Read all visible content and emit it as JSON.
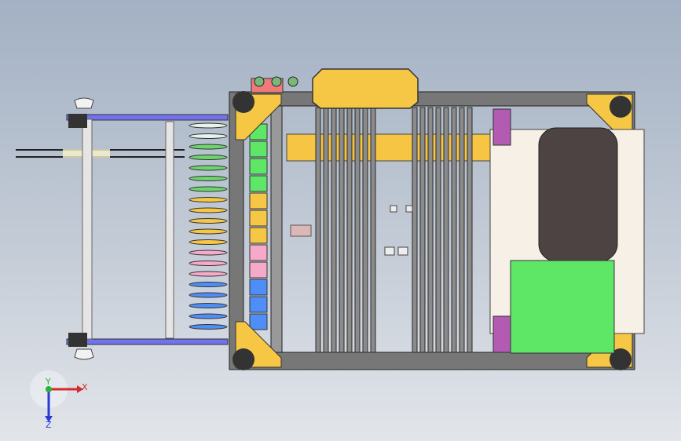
{
  "viewport": {
    "background_top": "#a3b1c4",
    "background_bottom": "#e2e5ea"
  },
  "model": {
    "frame_color": "#5c5c5c",
    "bracket_color": "#f6c744",
    "tray_color": "#f4dfa0",
    "panel_green": "#5ee667",
    "panel_dark": "#4e4444",
    "rail_color": "#8a8aff",
    "accent_pink": "#b35ab2"
  },
  "triad": {
    "x_label": "X",
    "y_label": "Y",
    "z_label": "Z",
    "x_color": "#d62a2a",
    "y_color": "#2ab33a",
    "z_color": "#2a3ad6"
  }
}
